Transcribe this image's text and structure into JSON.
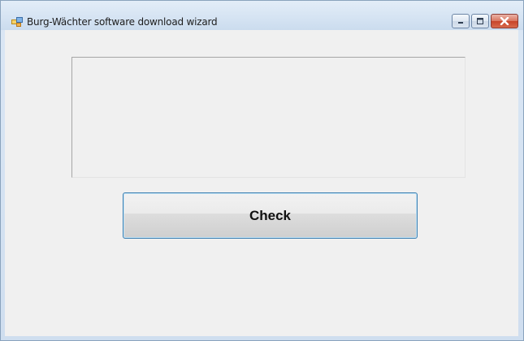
{
  "window": {
    "title": "Burg-Wächter software download wizard",
    "icon": "app-window-icon"
  },
  "caption_buttons": {
    "minimize_icon": "minimize-icon",
    "maximize_icon": "maximize-icon",
    "close_icon": "close-icon"
  },
  "main": {
    "text_area_value": "",
    "check_button_label": "Check"
  },
  "colors": {
    "client_background": "#f0f0f0",
    "button_focus_border": "#3c7fb1",
    "close_button": "#c7442a"
  }
}
